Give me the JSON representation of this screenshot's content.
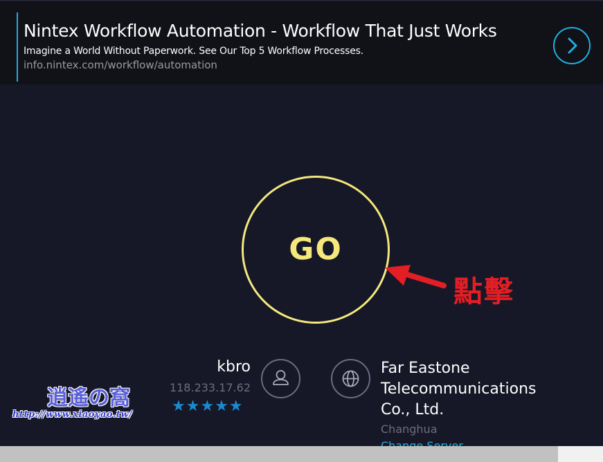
{
  "ad": {
    "title": "Nintex Workflow Automation - Workflow That Just Works",
    "subtitle": "Imagine a World Without Paperwork. See Our Top 5 Workflow Processes.",
    "url": "info.nintex.com/workflow/automation",
    "arrow_icon": "chevron-right-icon",
    "accent_color": "#1fb1df"
  },
  "go": {
    "label": "GO",
    "color": "#f5e87d"
  },
  "annotation": {
    "text": "點擊",
    "color": "#e31e25"
  },
  "isp": {
    "name": "kbro",
    "ip": "118.233.17.62",
    "stars": "★★★★★",
    "rating": 5,
    "icon": "user-icon"
  },
  "server": {
    "name": "Far Eastone Telecommunications Co., Ltd.",
    "location": "Changhua",
    "change_label": "Change Server",
    "icon": "globe-icon"
  },
  "watermark": {
    "title": "逍遙の窩",
    "url": "http://www.xiaoyao.tw/"
  },
  "colors": {
    "background": "#161827",
    "muted": "#6c6d7d",
    "star": "#1a8ad0"
  }
}
